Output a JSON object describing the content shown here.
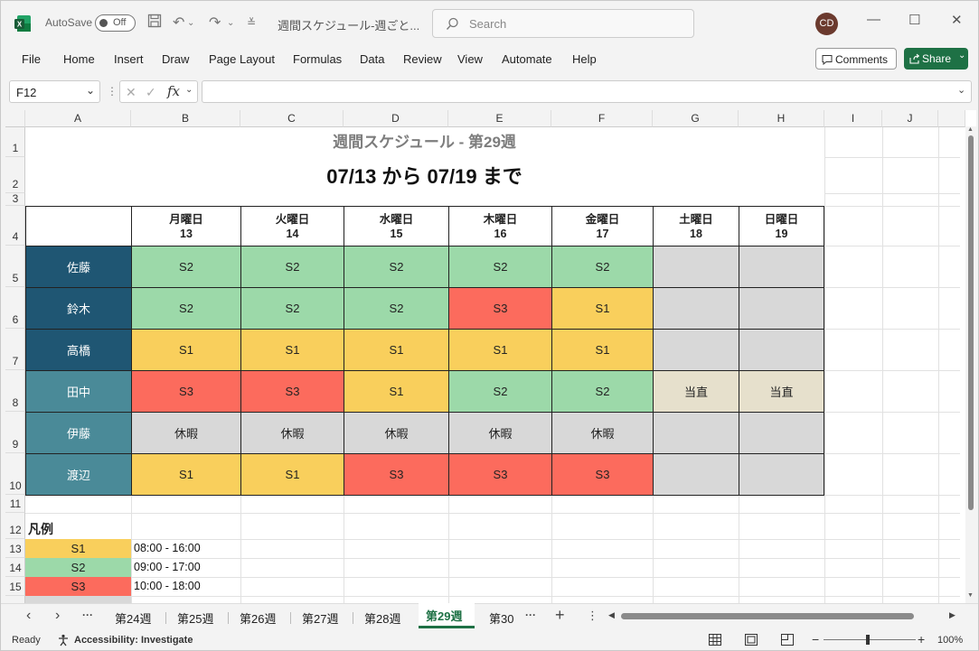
{
  "titlebar": {
    "autosave_label": "AutoSave",
    "autosave_state": "Off",
    "doc_title": "週間スケジュール-週ごと...",
    "search_placeholder": "Search",
    "avatar_initials": "CD"
  },
  "menu": [
    "File",
    "Home",
    "Insert",
    "Draw",
    "Page Layout",
    "Formulas",
    "Data",
    "Review",
    "View",
    "Automate",
    "Help"
  ],
  "buttons": {
    "comments": "Comments",
    "share": "Share"
  },
  "formula_bar": {
    "name_box": "F12",
    "fx": "fx",
    "formula": ""
  },
  "columns": [
    "A",
    "B",
    "C",
    "D",
    "E",
    "F",
    "G",
    "H",
    "I",
    "J"
  ],
  "rows": [
    "1",
    "2",
    "3",
    "4",
    "5",
    "6",
    "7",
    "8",
    "9",
    "10",
    "11",
    "12",
    "13",
    "14",
    "15"
  ],
  "sheet": {
    "title": "週間スケジュール - 第29週",
    "range": "07/13 から 07/19 まで",
    "days": [
      {
        "name": "月曜日",
        "num": "13"
      },
      {
        "name": "火曜日",
        "num": "14"
      },
      {
        "name": "水曜日",
        "num": "15"
      },
      {
        "name": "木曜日",
        "num": "16"
      },
      {
        "name": "金曜日",
        "num": "17"
      },
      {
        "name": "土曜日",
        "num": "18"
      },
      {
        "name": "日曜日",
        "num": "19"
      }
    ],
    "staff": [
      {
        "name": "佐藤",
        "shifts": [
          "S2",
          "S2",
          "S2",
          "S2",
          "S2",
          "",
          ""
        ]
      },
      {
        "name": "鈴木",
        "shifts": [
          "S2",
          "S2",
          "S2",
          "S3",
          "S1",
          "",
          ""
        ]
      },
      {
        "name": "高橋",
        "shifts": [
          "S1",
          "S1",
          "S1",
          "S1",
          "S1",
          "",
          ""
        ]
      },
      {
        "name": "田中",
        "shifts": [
          "S3",
          "S3",
          "S1",
          "S2",
          "S2",
          "当直",
          "当直"
        ]
      },
      {
        "name": "伊藤",
        "shifts": [
          "休暇",
          "休暇",
          "休暇",
          "休暇",
          "休暇",
          "",
          ""
        ]
      },
      {
        "name": "渡辺",
        "shifts": [
          "S1",
          "S1",
          "S3",
          "S3",
          "S3",
          "",
          ""
        ]
      }
    ],
    "legend_title": "凡例",
    "legend": [
      {
        "code": "S1",
        "time": "08:00 - 16:00"
      },
      {
        "code": "S2",
        "time": "09:00 - 17:00"
      },
      {
        "code": "S3",
        "time": "10:00 - 18:00"
      }
    ]
  },
  "tabs": [
    "第24週",
    "第25週",
    "第26週",
    "第27週",
    "第28週",
    "第29週",
    "第30"
  ],
  "active_tab": "第29週",
  "status": {
    "ready": "Ready",
    "accessibility": "Accessibility: Investigate",
    "zoom": "100%"
  },
  "colors": {
    "S1": "#f9cf5c",
    "S2": "#9cd9a9",
    "S3": "#fc6b5d",
    "off": "#d8d8d8",
    "duty": "#e6e0cc",
    "name_dark": "#1f5673",
    "name_mid": "#4a8a98",
    "accent": "#1e7145"
  }
}
